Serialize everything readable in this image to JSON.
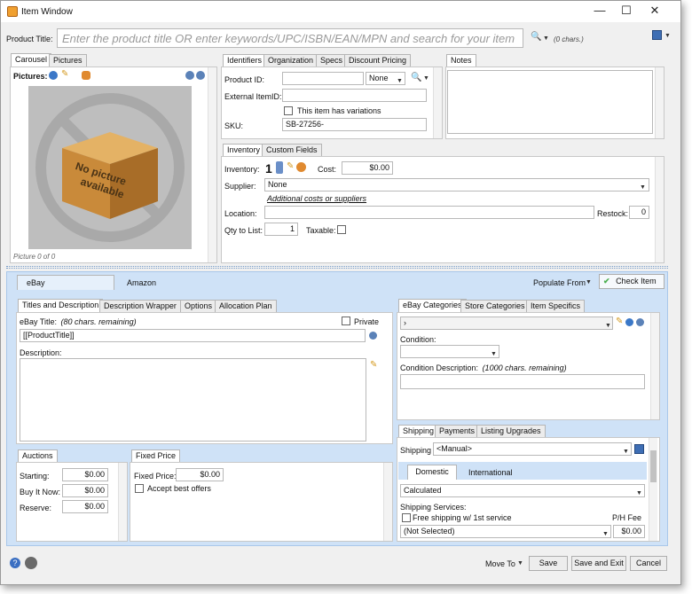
{
  "window": {
    "title": "Item Window",
    "minimize": "—",
    "maximize": "☐",
    "close": "✕"
  },
  "product_title": {
    "label": "Product Title:",
    "placeholder": "Enter the product title OR enter keywords/UPC/ISBN/EAN/MPN and search for your item",
    "chars": "(0 chars.)"
  },
  "left_tabs": [
    "Carousel",
    "Pictures"
  ],
  "pictures": {
    "label": "Pictures:",
    "placeholder_line1": "No picture",
    "placeholder_line2": "available",
    "counter": "Picture 0 of 0"
  },
  "ident_tabs": [
    "Identifiers",
    "Organization",
    "Specs",
    "Discount Pricing"
  ],
  "identifiers": {
    "product_id_label": "Product ID:",
    "product_id_type": "None",
    "external_id_label": "External ItemID:",
    "variations_label": "This item has variations",
    "sku_label": "SKU:",
    "sku_value": "SB-27256-"
  },
  "notes_tab": "Notes",
  "inv_tabs": [
    "Inventory",
    "Custom Fields"
  ],
  "inventory": {
    "inventory_label": "Inventory:",
    "inventory_value": "1",
    "cost_label": "Cost:",
    "cost_value": "$0.00",
    "supplier_label": "Supplier:",
    "supplier_value": "None",
    "additional_link": "Additional costs or suppliers",
    "location_label": "Location:",
    "restock_label": "Restock:",
    "restock_value": "0",
    "qty_label": "Qty to List:",
    "qty_value": "1",
    "taxable_label": "Taxable:"
  },
  "channel_tabs": [
    "eBay",
    "Amazon"
  ],
  "populate_from": "Populate From",
  "check_item": "Check Item",
  "title_tabs": [
    "Titles and Description",
    "Description Wrapper",
    "Options",
    "Allocation Plan"
  ],
  "ebay_title": {
    "label": "eBay Title:",
    "remaining": "(80 chars. remaining)",
    "private_label": "Private",
    "value": "[[ProductTitle]]"
  },
  "description_label": "Description:",
  "cat_tabs": [
    "eBay Categories",
    "Store Categories",
    "Item Specifics"
  ],
  "categories": {
    "selected": "›",
    "condition_label": "Condition:",
    "condition_desc_label": "Condition Description:",
    "condition_desc_remaining": "(1000 chars. remaining)"
  },
  "auctions": {
    "tab": "Auctions",
    "starting_label": "Starting:",
    "starting": "$0.00",
    "buyitnow_label": "Buy It Now:",
    "buyitnow": "$0.00",
    "reserve_label": "Reserve:",
    "reserve": "$0.00"
  },
  "fixed_price": {
    "tab": "Fixed Price",
    "label": "Fixed Price:",
    "value": "$0.00",
    "best_offer_label": "Accept best offers"
  },
  "ship_tabs": [
    "Shipping",
    "Payments",
    "Listing Upgrades"
  ],
  "shipping": {
    "label": "Shipping",
    "value": "<Manual>",
    "sub_tabs": [
      "Domestic",
      "International"
    ],
    "type": "Calculated",
    "services_label": "Shipping Services:",
    "free_label": "Free shipping w/ 1st service",
    "ph_fee_label": "P/H Fee",
    "service_value": "(Not Selected)",
    "fee_value": "$0.00"
  },
  "footer": {
    "move_to": "Move To",
    "save": "Save",
    "save_exit": "Save and Exit",
    "cancel": "Cancel"
  },
  "colors": {
    "accent": "#cfe2f7",
    "link": "#1a1a1a",
    "check": "#4caf50"
  }
}
